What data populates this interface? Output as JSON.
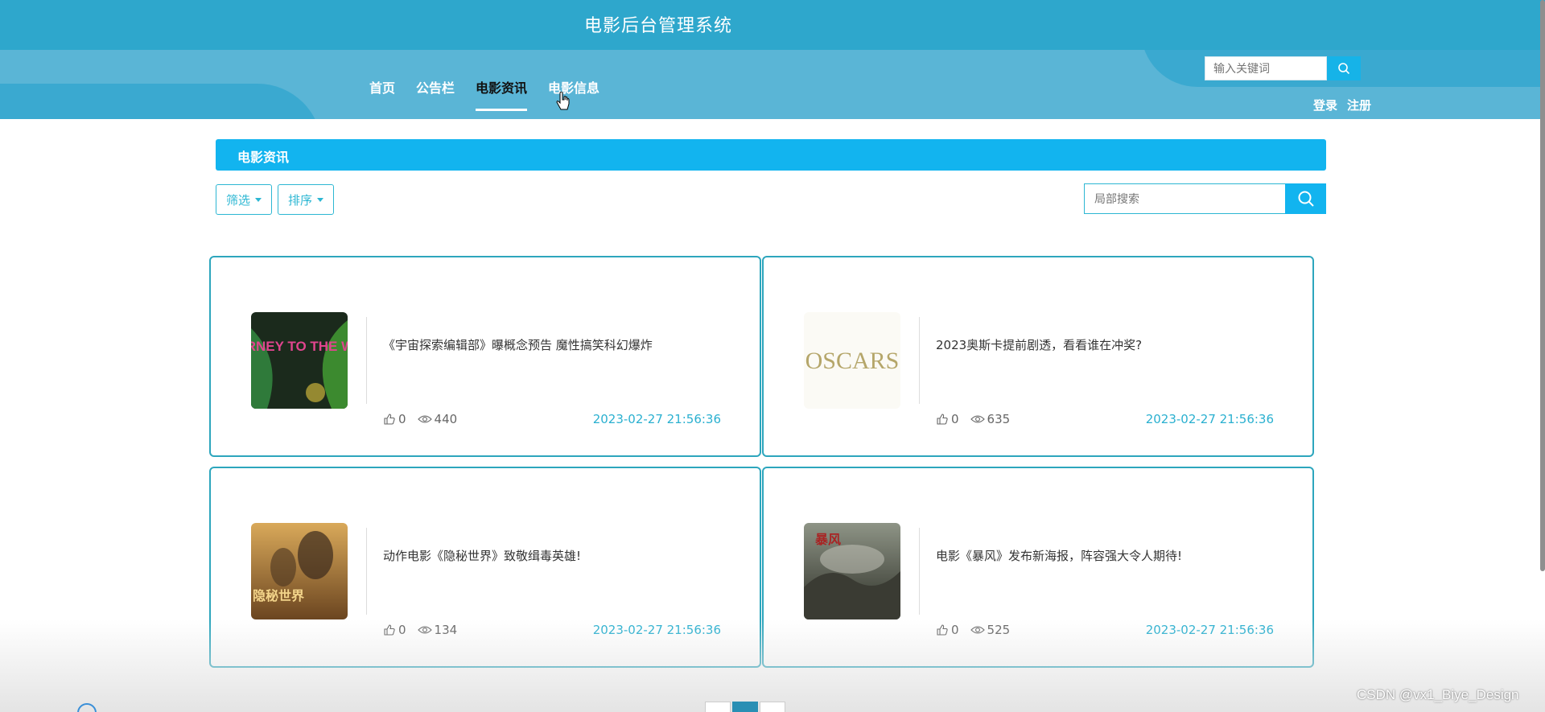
{
  "header": {
    "site_title": "电影后台管理系统",
    "nav": [
      "首页",
      "公告栏",
      "电影资讯",
      "电影信息"
    ],
    "active_nav": "电影资讯",
    "search_placeholder": "输入关键词",
    "login": "登录",
    "register": "注册"
  },
  "section": {
    "title": "电影资讯",
    "filter_label": "筛选",
    "sort_label": "排序",
    "search_placeholder": "局部搜索"
  },
  "cards": [
    {
      "title": "《宇宙探索编辑部》曝概念预告 魔性搞笑科幻爆炸",
      "likes": "0",
      "views": "440",
      "time": "2023-02-27 21:56:36",
      "thumb_text": "JOURNEY TO THE WEST"
    },
    {
      "title": "2023奥斯卡提前剧透，看看谁在冲奖?",
      "likes": "0",
      "views": "635",
      "time": "2023-02-27 21:56:36",
      "thumb_text": "OSCARS"
    },
    {
      "title": "动作电影《隐秘世界》致敬缉毒英雄!",
      "likes": "0",
      "views": "134",
      "time": "2023-02-27 21:56:36",
      "thumb_text": "隐秘世界"
    },
    {
      "title": "电影《暴风》发布新海报，阵容强大令人期待!",
      "likes": "0",
      "views": "525",
      "time": "2023-02-27 21:56:36",
      "thumb_text": "暴风"
    }
  ],
  "watermark": "CSDN @vx1_Biye_Design",
  "colors": {
    "header": "#2ea7cc",
    "nav_band": "#5ab5d6",
    "accent": "#12b4ef",
    "card_border": "#2da6bd",
    "time_text": "#2ab0d0"
  }
}
